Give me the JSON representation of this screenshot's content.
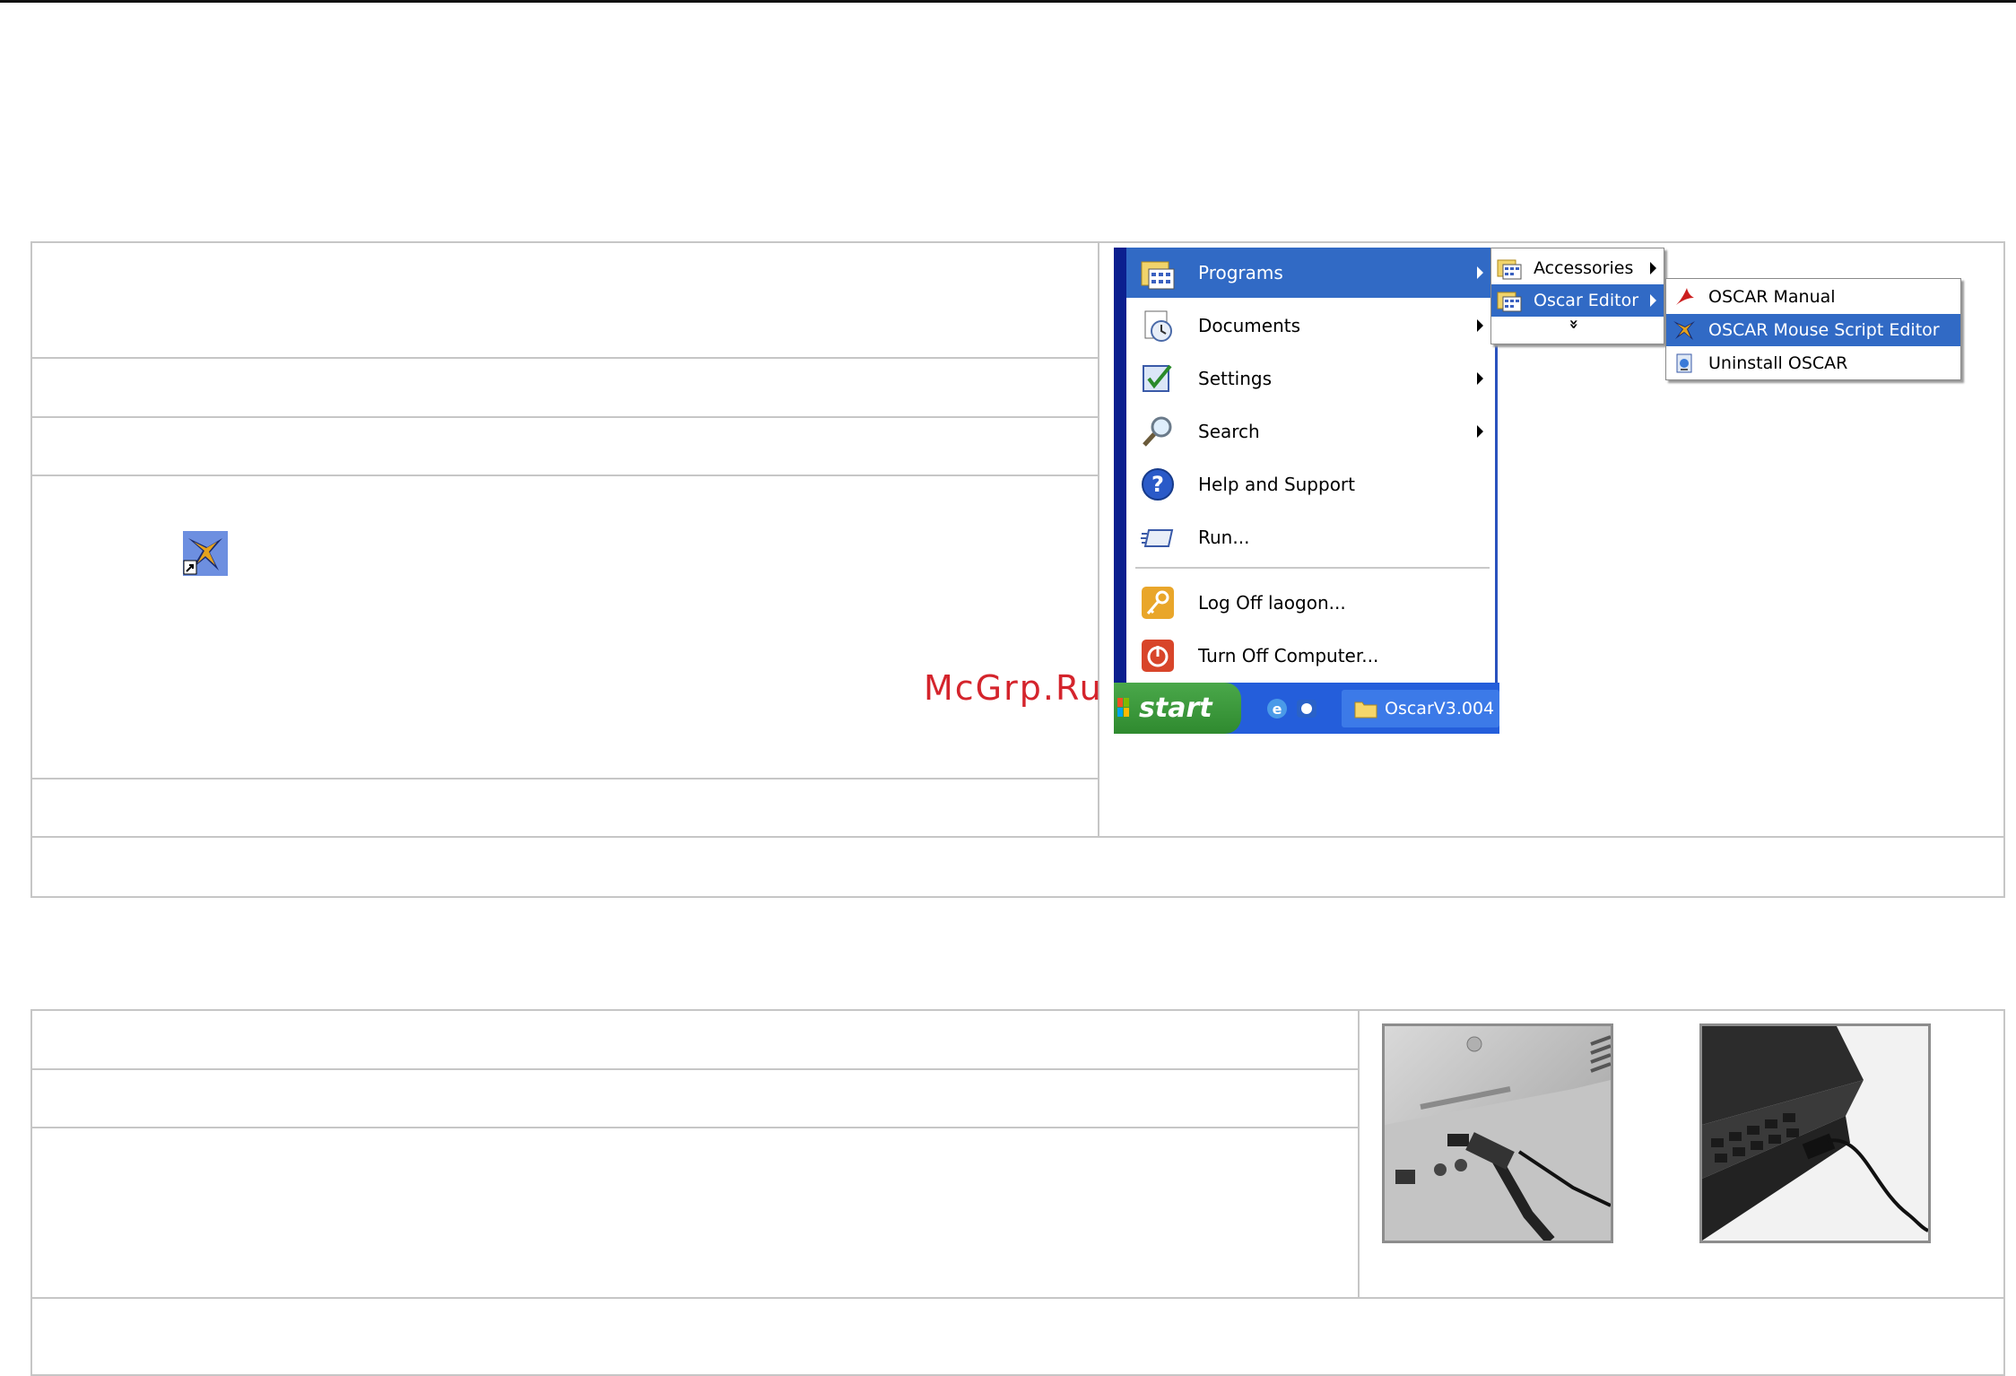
{
  "watermark": "McGrp.Ru",
  "start_menu": {
    "items": [
      {
        "label": "Programs",
        "icon": "programs-icon"
      },
      {
        "label": "Documents",
        "icon": "documents-icon"
      },
      {
        "label": "Settings",
        "icon": "settings-icon"
      },
      {
        "label": "Search",
        "icon": "search-icon"
      },
      {
        "label": "Help and Support",
        "icon": "help-icon"
      },
      {
        "label": "Run...",
        "icon": "run-icon"
      },
      {
        "label": "Log Off laogon...",
        "icon": "key-icon"
      },
      {
        "label": "Turn Off Computer...",
        "icon": "power-icon"
      }
    ],
    "programs_submenu": [
      {
        "label": "Accessories"
      },
      {
        "label": "Oscar Editor"
      }
    ],
    "expand_glyph": "»",
    "oscar_submenu": [
      {
        "label": "OSCAR Manual"
      },
      {
        "label": "OSCAR Mouse Script Editor"
      },
      {
        "label": "Uninstall OSCAR"
      }
    ],
    "taskbar": {
      "start_label": "start",
      "task_button": "OscarV3.004"
    }
  },
  "colors": {
    "highlight": "#316ac5",
    "taskbar": "#245edb",
    "start_green": "#3a9a3a",
    "border": "#c6c6c6"
  }
}
